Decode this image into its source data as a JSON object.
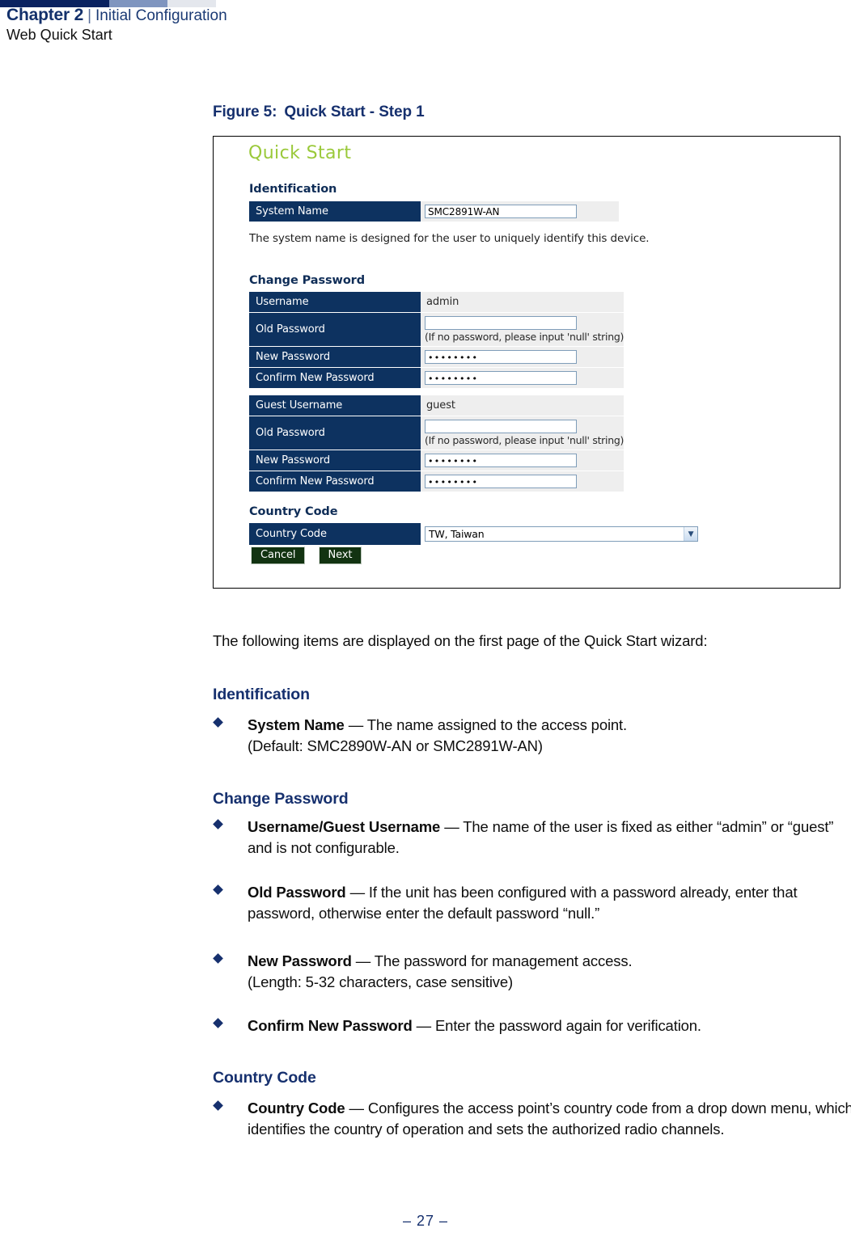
{
  "header": {
    "chapter": "Chapter 2",
    "separator": "|",
    "section": "Initial Configuration",
    "subsection": "Web Quick Start",
    "band_colors": [
      "#0a2260",
      "#7f95bf",
      "#e4e7ed"
    ]
  },
  "figure": {
    "number": "Figure 5:",
    "title": "Quick Start - Step 1"
  },
  "screenshot": {
    "title": "Quick Start",
    "title_color": "#9ac93a",
    "identification": {
      "heading": "Identification",
      "rows": [
        {
          "label": "System Name",
          "value": "SMC2891W-AN",
          "type": "textbox"
        }
      ],
      "helper_text": "The system name is designed for the user to uniquely identify this device."
    },
    "change_password": {
      "heading": "Change Password",
      "admin_rows": [
        {
          "label": "Username",
          "value": "admin",
          "type": "plain"
        },
        {
          "label": "Old Password",
          "value": "",
          "type": "textbox",
          "note": "(If no password, please input 'null' string)"
        },
        {
          "label": "New Password",
          "value": "••••••••",
          "type": "textbox"
        },
        {
          "label": "Confirm New Password",
          "value": "••••••••",
          "type": "textbox"
        }
      ],
      "guest_rows": [
        {
          "label": "Guest Username",
          "value": "guest",
          "type": "plain"
        },
        {
          "label": "Old Password",
          "value": "",
          "type": "textbox",
          "note": "(If no password, please input 'null' string)"
        },
        {
          "label": "New Password",
          "value": "••••••••",
          "type": "textbox"
        },
        {
          "label": "Confirm New Password",
          "value": "••••••••",
          "type": "textbox"
        }
      ]
    },
    "country_code": {
      "heading": "Country Code",
      "label": "Country Code",
      "selected": "TW, Taiwan",
      "arrow_icon": "chevron-down-icon"
    },
    "buttons": {
      "cancel": "Cancel",
      "next": "Next",
      "color": "#123311"
    }
  },
  "body": {
    "intro": "The following items are displayed on the first page of the Quick Start wizard:",
    "sections": [
      {
        "heading": "Identification",
        "items": [
          {
            "term": "System Name",
            "dash": " — ",
            "desc": "The name assigned to the access point.",
            "extra": "(Default: SMC2890W-AN or SMC2891W-AN)"
          }
        ]
      },
      {
        "heading": "Change Password",
        "items": [
          {
            "term": "Username/Guest Username",
            "dash": " — ",
            "desc": "The name of the user is fixed as either “admin” or “guest” and is not configurable.",
            "extra": ""
          },
          {
            "term": "Old Password",
            "dash": " — ",
            "desc": "If the unit has been configured with a password already, enter that password, otherwise enter the default password “null.”",
            "extra": ""
          },
          {
            "term": "New Password",
            "dash": " — ",
            "desc": "The password for management access.",
            "extra": "(Length: 5-32 characters, case sensitive)"
          },
          {
            "term": "Confirm New Password",
            "dash": " — ",
            "desc": "Enter the password again for verification.",
            "extra": ""
          }
        ]
      },
      {
        "heading": "Country Code",
        "items": [
          {
            "term": "Country Code",
            "dash": " — ",
            "desc": "Configures the access point’s country code from a drop down menu, which identifies the country of operation and sets the authorized radio channels.",
            "extra": ""
          }
        ]
      }
    ]
  },
  "footer": {
    "page": "–  27  –"
  }
}
